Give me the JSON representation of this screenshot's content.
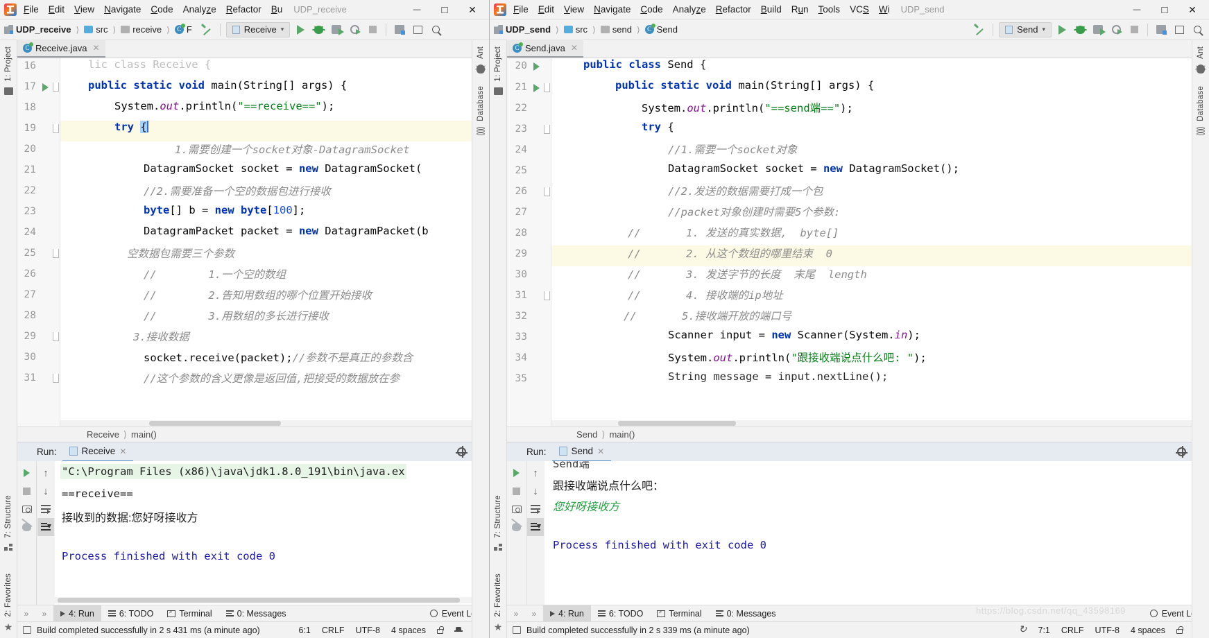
{
  "left": {
    "window_title": "UDP_receive",
    "menu": [
      "File",
      "Edit",
      "View",
      "Navigate",
      "Code",
      "Analyze",
      "Refactor",
      "Bu"
    ],
    "breadcrumb": [
      "UDP_receive",
      "src",
      "receive",
      "F"
    ],
    "run_config": "Receive",
    "file_tab": "Receive.java",
    "side_tabs": [
      "1: Project",
      "7: Structure",
      "2: Favorites"
    ],
    "right_tabs": [
      "Ant",
      "Database"
    ],
    "code_lines": [
      {
        "num": "16",
        "text": "lic class Receive {",
        "clipped": true
      },
      {
        "num": "17",
        "text": "public static void main(String[] args) {"
      },
      {
        "num": "18",
        "text": "System.out.println(\"==receive==\");"
      },
      {
        "num": "19",
        "text": "try {",
        "highlight": true
      },
      {
        "num": "20",
        "text": "1.需要创建一个socket对象-DatagramSocket"
      },
      {
        "num": "21",
        "text": "DatagramSocket socket = new DatagramSocket("
      },
      {
        "num": "22",
        "text": "//2.需要准备一个空的数据包进行接收"
      },
      {
        "num": "23",
        "text": "byte[] b = new byte[100];"
      },
      {
        "num": "24",
        "text": "DatagramPacket packet = new DatagramPacket(b"
      },
      {
        "num": "25",
        "text": "空数据包需要三个参数"
      },
      {
        "num": "26",
        "text": "//          1.一个空的数组"
      },
      {
        "num": "27",
        "text": "//          2.告知用数组的哪个位置开始接收"
      },
      {
        "num": "28",
        "text": "//          3.用数组的多长进行接收"
      },
      {
        "num": "29",
        "text": "3.接收数据"
      },
      {
        "num": "30",
        "text": "socket.receive(packet);//参数不是真正的参数含"
      },
      {
        "num": "31",
        "text": "//这个参数的含义更像是返回值,把接受的数据放在参"
      }
    ],
    "editor_crumb": [
      "Receive",
      "main()"
    ],
    "run": {
      "label": "Run:",
      "tab": "Receive",
      "lines": [
        {
          "text": "\"C:\\Program Files (x86)\\java\\jdk1.8.0_191\\bin\\java.ex",
          "kind": "cmd"
        },
        {
          "text": "==receive==",
          "kind": "out"
        },
        {
          "text": "接收到的数据:您好呀接收方",
          "kind": "out"
        },
        {
          "text": "Process finished with exit code 0",
          "kind": "exit"
        }
      ]
    },
    "toolstrip": [
      "4: Run",
      "6: TODO",
      "Terminal",
      "0: Messages"
    ],
    "event_log": "Event Log",
    "status": {
      "message": "Build completed successfully in 2 s 431 ms (a minute ago)",
      "caret": "6:1",
      "line_sep": "CRLF",
      "encoding": "UTF-8",
      "indent": "4 spaces"
    }
  },
  "right": {
    "window_title": "UDP_send",
    "menu": [
      "File",
      "Edit",
      "View",
      "Navigate",
      "Code",
      "Analyze",
      "Refactor",
      "Build",
      "Run",
      "Tools",
      "VCS",
      "Wi"
    ],
    "breadcrumb": [
      "UDP_send",
      "src",
      "send",
      "Send"
    ],
    "run_config": "Send",
    "file_tab": "Send.java",
    "side_tabs": [
      "1: Project",
      "7: Structure",
      "2: Favorites"
    ],
    "right_tabs": [
      "Ant",
      "Database"
    ],
    "code_lines": [
      {
        "num": "20",
        "text": "public class Send {"
      },
      {
        "num": "21",
        "text": "public static void main(String[] args) {"
      },
      {
        "num": "22",
        "text": "System.out.println(\"==send端==\");"
      },
      {
        "num": "23",
        "text": "try {"
      },
      {
        "num": "24",
        "text": "//1.需要一个socket对象"
      },
      {
        "num": "25",
        "text": "DatagramSocket socket = new DatagramSocket();"
      },
      {
        "num": "26",
        "text": "//2.发送的数据需要打成一个包"
      },
      {
        "num": "27",
        "text": "//packet对象创建时需要5个参数:"
      },
      {
        "num": "28",
        "text": "//       1. 发送的真实数据,  byte[]"
      },
      {
        "num": "29",
        "text": "//       2. 从这个数组的哪里结束  0",
        "highlight": true
      },
      {
        "num": "30",
        "text": "//       3. 发送字节的长度  末尾  length"
      },
      {
        "num": "31",
        "text": "//       4. 接收端的ip地址"
      },
      {
        "num": "32",
        "text": "//       5.接收端开放的端口号"
      },
      {
        "num": "33",
        "text": "Scanner input = new Scanner(System.in);"
      },
      {
        "num": "34",
        "text": "System.out.println(\"跟接收端说点什么吧: \");"
      },
      {
        "num": "35",
        "text": "String message = input.nextLine();",
        "clipped": true
      }
    ],
    "editor_crumb": [
      "Send",
      "main()"
    ],
    "run": {
      "label": "Run:",
      "tab": "Send",
      "lines": [
        {
          "text": "Send端",
          "kind": "clip"
        },
        {
          "text": "跟接收端说点什么吧：",
          "kind": "out"
        },
        {
          "text": "您好呀接收方",
          "kind": "inp"
        },
        {
          "text": "Process finished with exit code 0",
          "kind": "exit"
        }
      ]
    },
    "toolstrip": [
      "4: Run",
      "6: TODO",
      "Terminal",
      "0: Messages"
    ],
    "event_log": "Event Log",
    "status": {
      "message": "Build completed successfully in 2 s 339 ms (a minute ago)",
      "caret": "7:1",
      "line_sep": "CRLF",
      "encoding": "UTF-8",
      "indent": "4 spaces"
    },
    "watermark": "https://blog.csdn.net/qq_43598169"
  }
}
